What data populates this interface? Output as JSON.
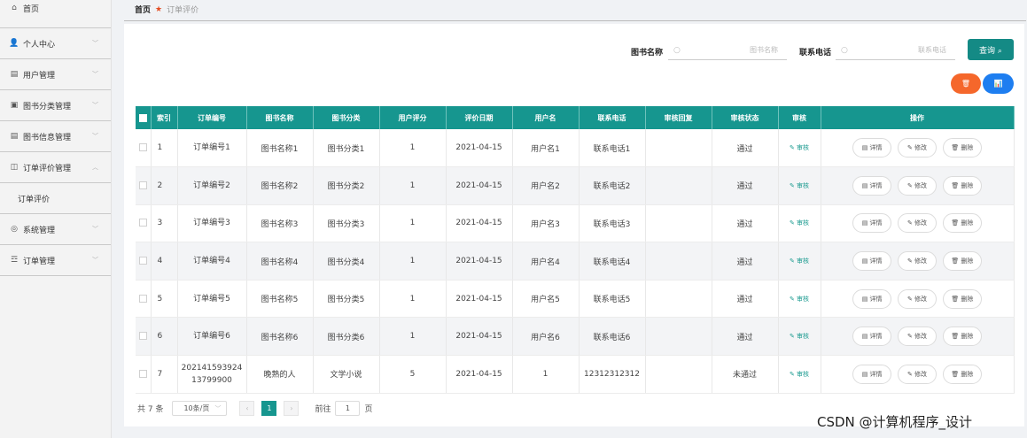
{
  "sidebar": {
    "home": "首页",
    "items": [
      {
        "label": "个人中心",
        "icon": "user-icon",
        "glyph": "👤"
      },
      {
        "label": "用户管理",
        "icon": "users-icon",
        "glyph": "▤"
      },
      {
        "label": "图书分类管理",
        "icon": "category-icon",
        "glyph": "▣"
      },
      {
        "label": "图书信息管理",
        "icon": "book-icon",
        "glyph": "▤"
      },
      {
        "label": "订单评价管理",
        "icon": "review-icon",
        "glyph": "◫"
      },
      {
        "label": "订单评价"
      },
      {
        "label": "系统管理",
        "icon": "system-icon",
        "glyph": "◎"
      },
      {
        "label": "订单管理",
        "icon": "order-icon",
        "glyph": "☲"
      }
    ]
  },
  "breadcrumb": {
    "home": "首页",
    "current": "订单评价"
  },
  "search": {
    "book_label": "图书名称",
    "book_placeholder": "图书名称",
    "phone_label": "联系电话",
    "phone_placeholder": "联系电话",
    "query_button": "查询 ⌕"
  },
  "actions": {
    "delete_glyph": "🗑",
    "chart_glyph": "📊"
  },
  "table": {
    "headers": [
      "索引",
      "订单编号",
      "图书名称",
      "图书分类",
      "用户评分",
      "评价日期",
      "用户名",
      "联系电话",
      "审核回复",
      "审核状态",
      "审核",
      "操作"
    ],
    "rows": [
      {
        "index": "1",
        "order_no": "订单编号1",
        "book": "图书名称1",
        "category": "图书分类1",
        "score": "1",
        "date": "2021-04-15",
        "user": "用户名1",
        "phone": "联系电话1",
        "reply": "",
        "status": "通过"
      },
      {
        "index": "2",
        "order_no": "订单编号2",
        "book": "图书名称2",
        "category": "图书分类2",
        "score": "1",
        "date": "2021-04-15",
        "user": "用户名2",
        "phone": "联系电话2",
        "reply": "",
        "status": "通过"
      },
      {
        "index": "3",
        "order_no": "订单编号3",
        "book": "图书名称3",
        "category": "图书分类3",
        "score": "1",
        "date": "2021-04-15",
        "user": "用户名3",
        "phone": "联系电话3",
        "reply": "",
        "status": "通过"
      },
      {
        "index": "4",
        "order_no": "订单编号4",
        "book": "图书名称4",
        "category": "图书分类4",
        "score": "1",
        "date": "2021-04-15",
        "user": "用户名4",
        "phone": "联系电话4",
        "reply": "",
        "status": "通过"
      },
      {
        "index": "5",
        "order_no": "订单编号5",
        "book": "图书名称5",
        "category": "图书分类5",
        "score": "1",
        "date": "2021-04-15",
        "user": "用户名5",
        "phone": "联系电话5",
        "reply": "",
        "status": "通过"
      },
      {
        "index": "6",
        "order_no": "订单编号6",
        "book": "图书名称6",
        "category": "图书分类6",
        "score": "1",
        "date": "2021-04-15",
        "user": "用户名6",
        "phone": "联系电话6",
        "reply": "",
        "status": "通过"
      },
      {
        "index": "7",
        "order_no": "202141593924\n13799900",
        "book": "晚熟的人",
        "category": "文学小说",
        "score": "5",
        "date": "2021-04-15",
        "user": "1",
        "phone": "12312312312",
        "reply": "",
        "status": "未通过"
      }
    ],
    "audit_label": "✎ 审核",
    "detail_label": "▤ 详情",
    "edit_label": "✎ 修改",
    "delete_label": "🗑 删除"
  },
  "pagination": {
    "total": "共 7 条",
    "page_size": "10条/页",
    "prev": "‹",
    "current_page": "1",
    "next": "›",
    "goto_prefix": "前往",
    "goto_value": "1",
    "goto_suffix": "页"
  },
  "watermark": "CSDN @计算机程序_设计"
}
